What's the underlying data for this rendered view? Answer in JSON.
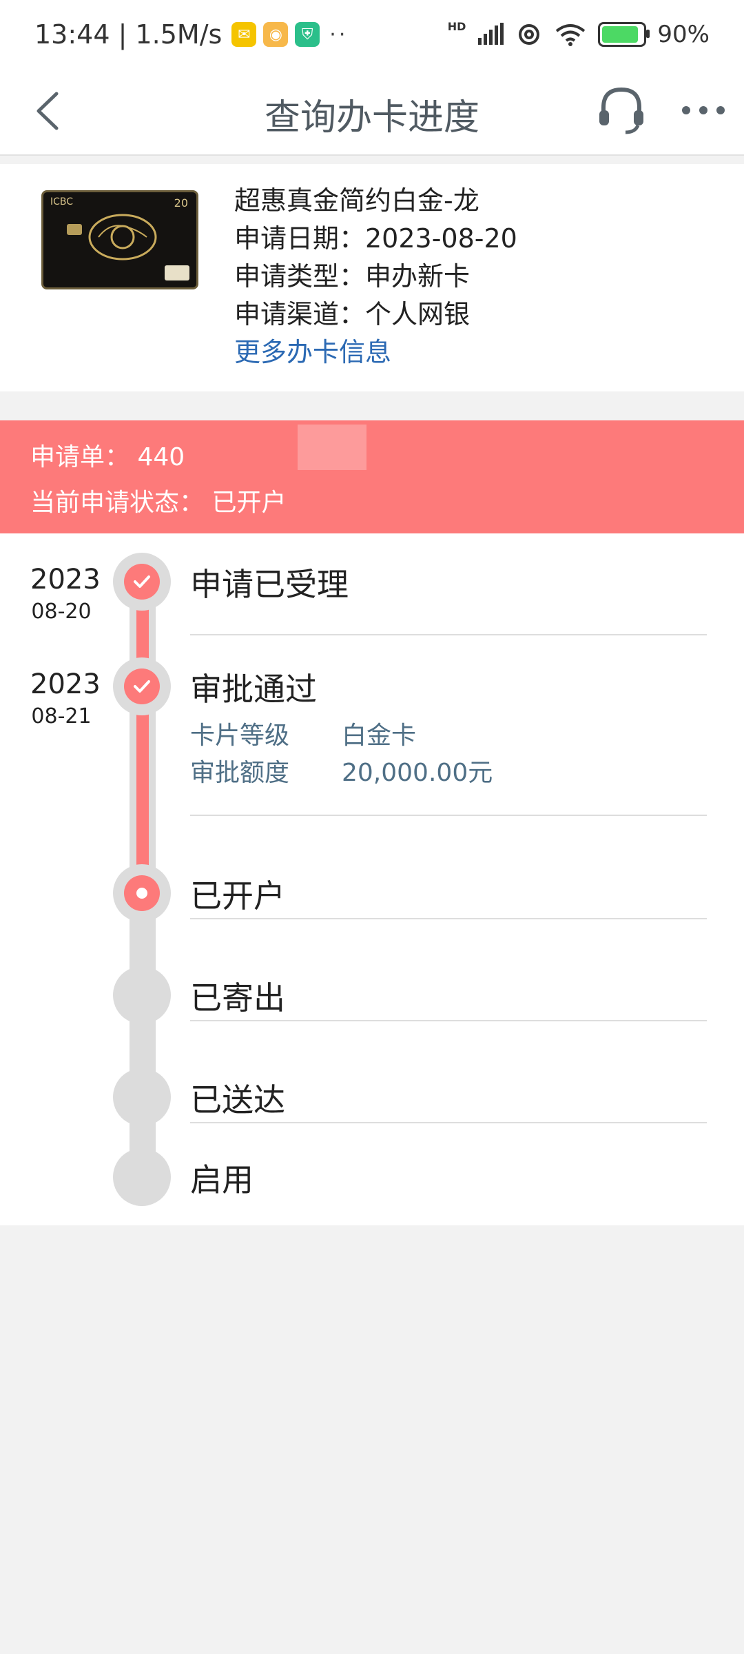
{
  "status_bar": {
    "time_speed": "13:44 | 1.5M/s",
    "dots": "··",
    "signal": "HD",
    "battery_level": "90%"
  },
  "nav": {
    "title": "查询办卡进度"
  },
  "card": {
    "name": "超惠真金简约白金-龙",
    "apply_date": "申请日期：2023-08-20",
    "apply_type": "申请类型：申办新卡",
    "apply_channel": "申请渠道：个人网银",
    "more_link": "更多办卡信息",
    "card_brand": "ICBC",
    "card_badge": "20"
  },
  "banner": {
    "application_label": "申请单：",
    "application_number": "440",
    "status_label": "当前申请状态：",
    "status_value": "已开户"
  },
  "timeline": {
    "steps": [
      {
        "title": "申请已受理",
        "year": "2023",
        "md": "08-20",
        "state": "done"
      },
      {
        "title": "审批通过",
        "year": "2023",
        "md": "08-21",
        "state": "done",
        "details": [
          {
            "label": "卡片等级",
            "value": "白金卡"
          },
          {
            "label": "审批额度",
            "value": "20,000.00元"
          }
        ]
      },
      {
        "title": "已开户",
        "state": "current"
      },
      {
        "title": "已寄出",
        "state": "pending"
      },
      {
        "title": "已送达",
        "state": "pending"
      },
      {
        "title": "启用",
        "state": "pending"
      }
    ]
  },
  "colors": {
    "accent": "#fd7a7a",
    "link": "#2b69b3",
    "track": "#dcdcdc",
    "detail_text": "#4f6f86"
  }
}
